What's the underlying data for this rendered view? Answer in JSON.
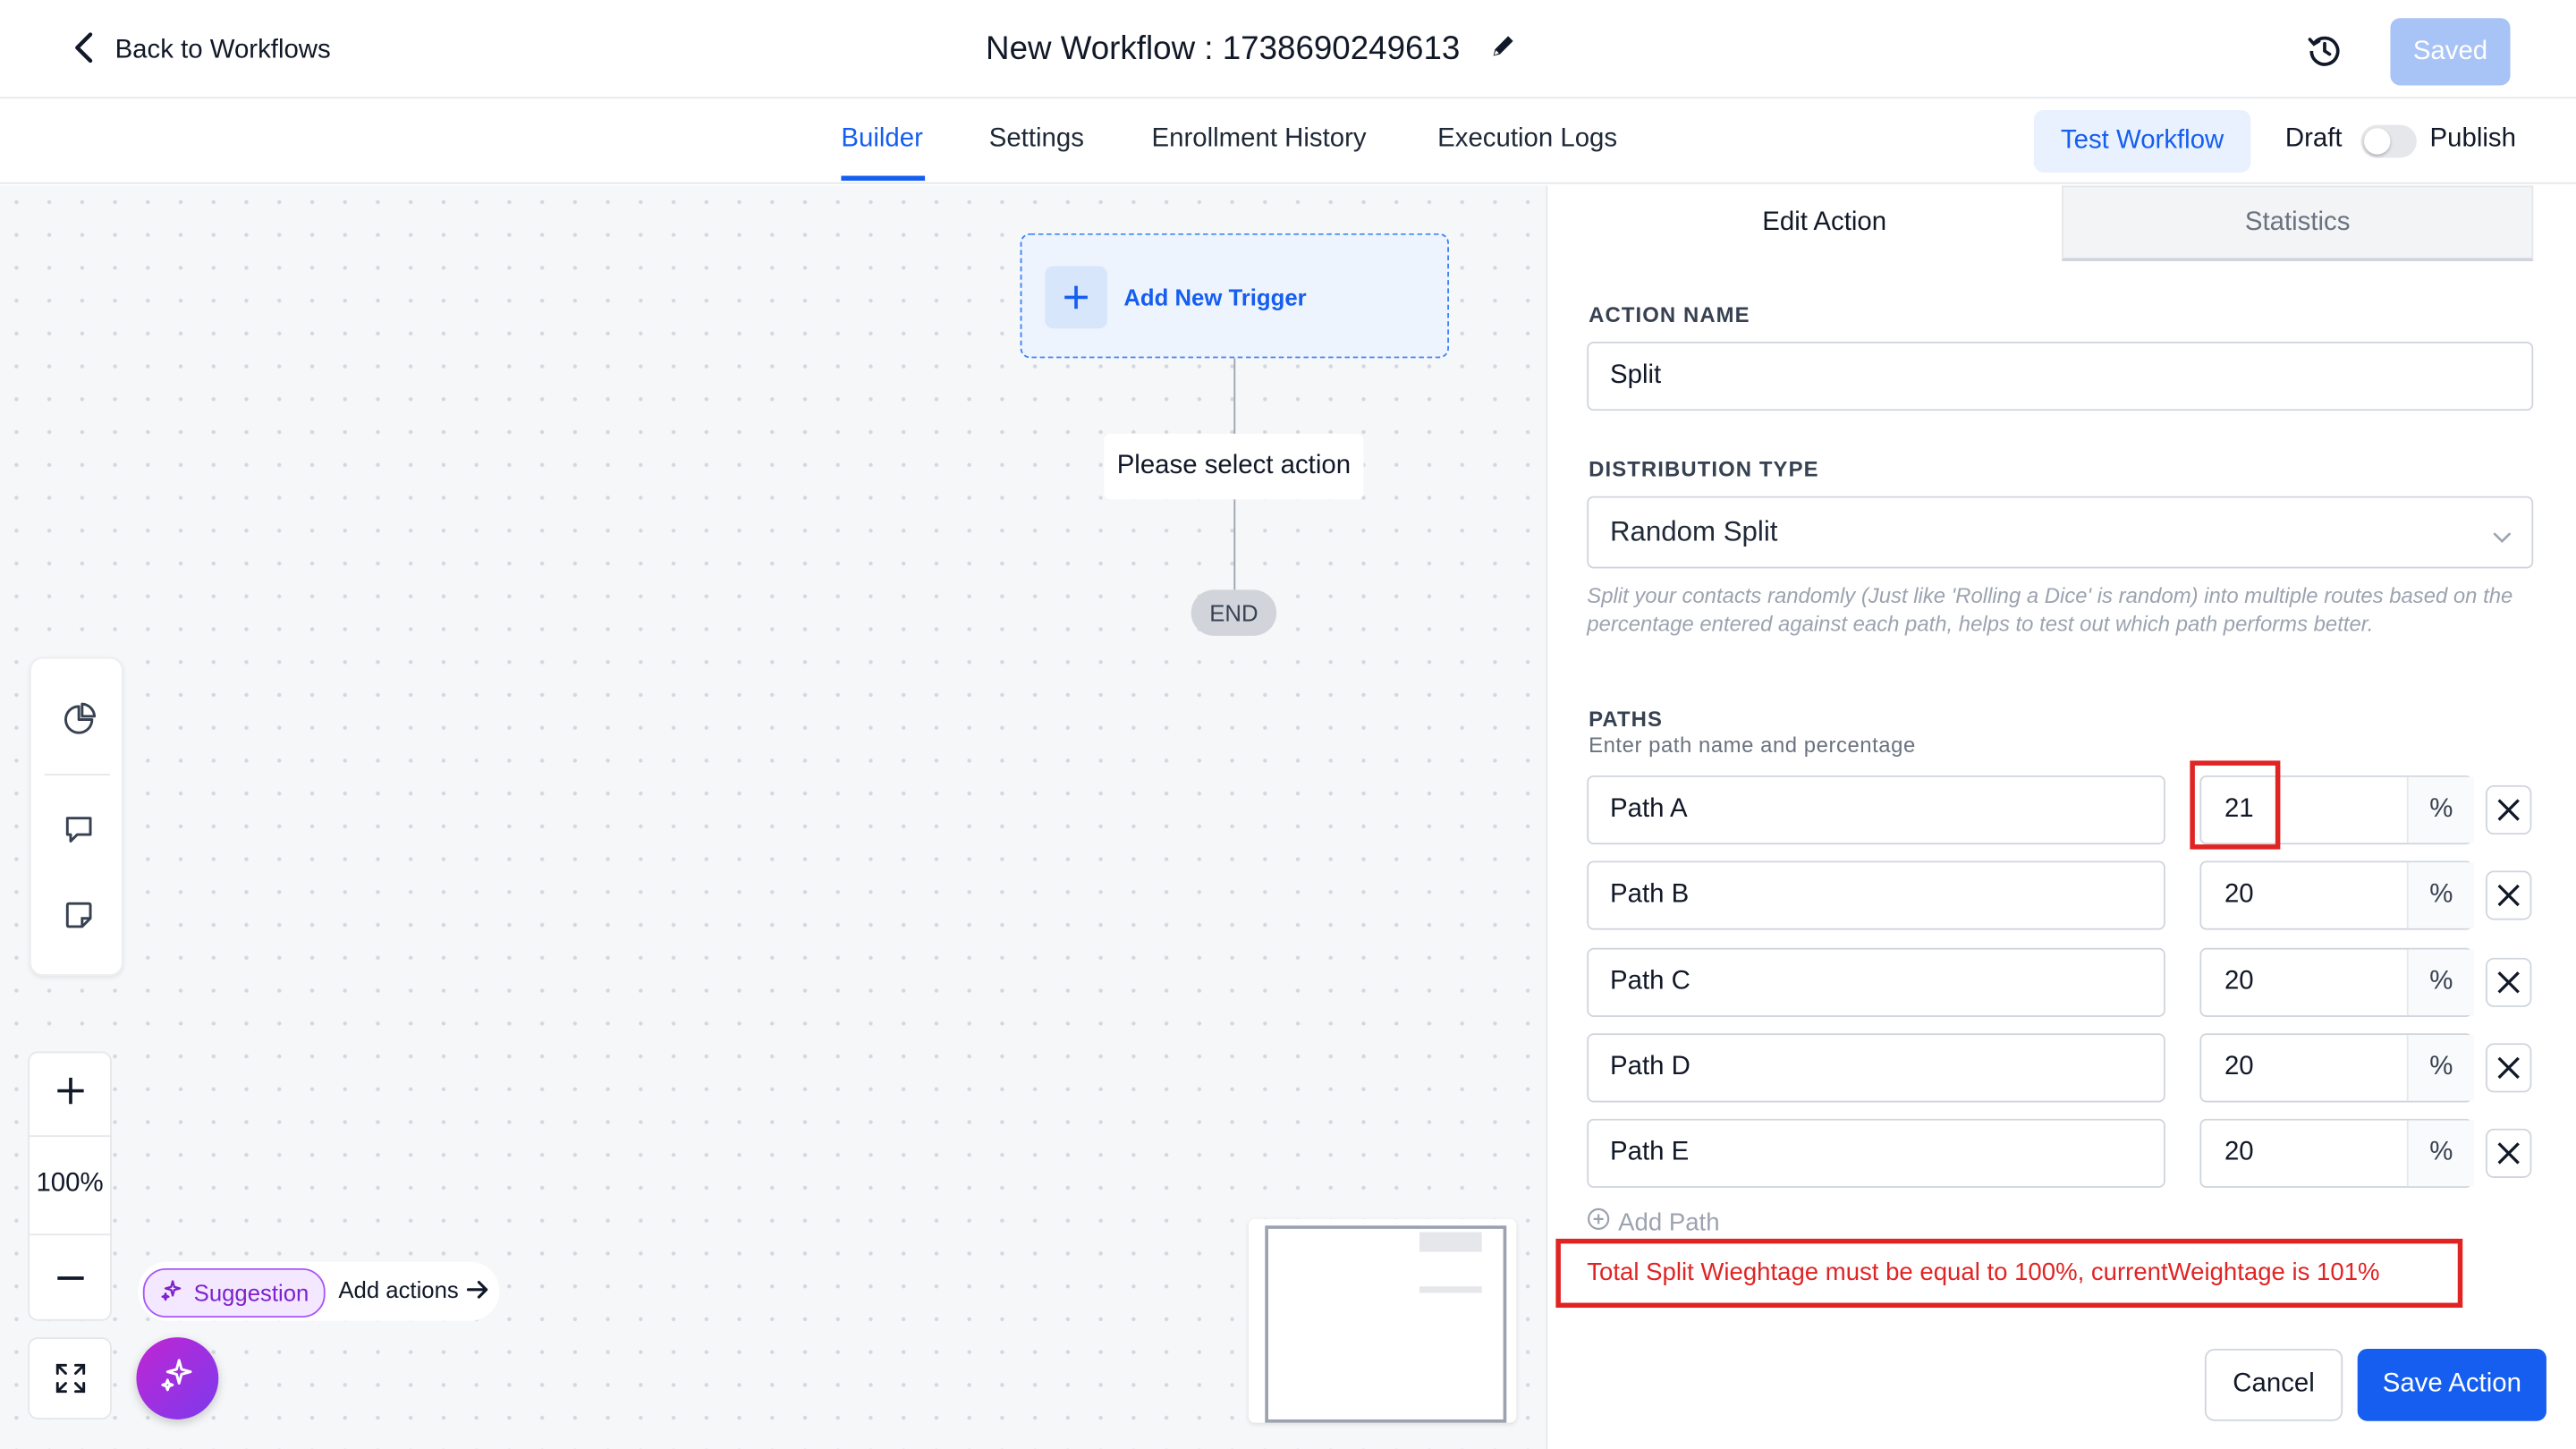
{
  "header": {
    "back_label": "Back to Workflows",
    "title": "New Workflow : 1738690249613",
    "saved_label": "Saved"
  },
  "tabs": {
    "builder": "Builder",
    "settings": "Settings",
    "enrollment": "Enrollment History",
    "logs": "Execution Logs",
    "active": "Builder"
  },
  "actions": {
    "test": "Test Workflow",
    "draft": "Draft",
    "publish": "Publish",
    "publish_on": false
  },
  "canvas": {
    "trigger_label": "Add New Trigger",
    "select_action": "Please select action",
    "end_label": "END",
    "zoom": "100%",
    "suggestion_label": "Suggestion",
    "suggestion_text": "Add actions"
  },
  "panel": {
    "tab_edit": "Edit Action",
    "tab_stats": "Statistics",
    "action_name_label": "ACTION NAME",
    "action_name_value": "Split",
    "distribution_label": "DISTRIBUTION TYPE",
    "distribution_value": "Random Split",
    "distribution_help": "Split your contacts randomly (Just like 'Rolling a Dice' is random) into multiple routes based on the percentage entered against each path, helps to test out which path performs better.",
    "paths_label": "PATHS",
    "paths_sub": "Enter path name and percentage",
    "paths": [
      {
        "name": "Path A",
        "percent": "21",
        "suffix": "%"
      },
      {
        "name": "Path B",
        "percent": "20",
        "suffix": "%"
      },
      {
        "name": "Path C",
        "percent": "20",
        "suffix": "%"
      },
      {
        "name": "Path D",
        "percent": "20",
        "suffix": "%"
      },
      {
        "name": "Path E",
        "percent": "20",
        "suffix": "%"
      }
    ],
    "add_path": "Add Path",
    "error": "Total Split Wieghtage must be equal to 100%, currentWeightage is 101%",
    "cancel": "Cancel",
    "save": "Save Action"
  },
  "colors": {
    "accent": "#155eef",
    "error": "#e02424",
    "saved_disabled": "#a8c3f5",
    "ai_gradient": "#c026d3"
  },
  "icons": [
    "chevron-left-icon",
    "pencil-icon",
    "history-icon",
    "plus-icon",
    "pie-chart-icon",
    "comment-icon",
    "sticky-note-icon",
    "zoom-in-icon",
    "zoom-out-icon",
    "fit-view-icon",
    "sparkle-icon",
    "arrow-right-icon",
    "chevron-down-icon",
    "close-icon",
    "add-circle-icon"
  ]
}
